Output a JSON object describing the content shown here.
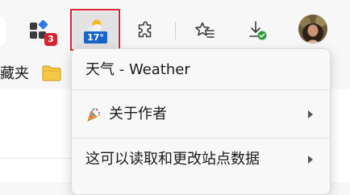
{
  "toolbar": {
    "extensions_badge_count": "3",
    "weather_temperature": "17°",
    "icons": [
      "extensions-icon",
      "weather-icon",
      "puzzle-icon",
      "favorites-icon",
      "downloads-icon",
      "profile-avatar"
    ],
    "colors": {
      "badge": "#d5232f",
      "temperature_chip": "#1665c7",
      "highlight_box": "#d9232e",
      "download_check": "#2e9b3e"
    }
  },
  "favorites_bar": {
    "partial_label": "藏夹",
    "folder_icon": "folder-icon"
  },
  "context_menu": {
    "items": [
      {
        "label": "天气 - Weather",
        "has_submenu": false
      },
      {
        "label": "关于作者",
        "icon": "party-popper-icon",
        "has_submenu": true
      },
      {
        "label": "这可以读取和更改站点数据",
        "has_submenu": true
      }
    ]
  }
}
